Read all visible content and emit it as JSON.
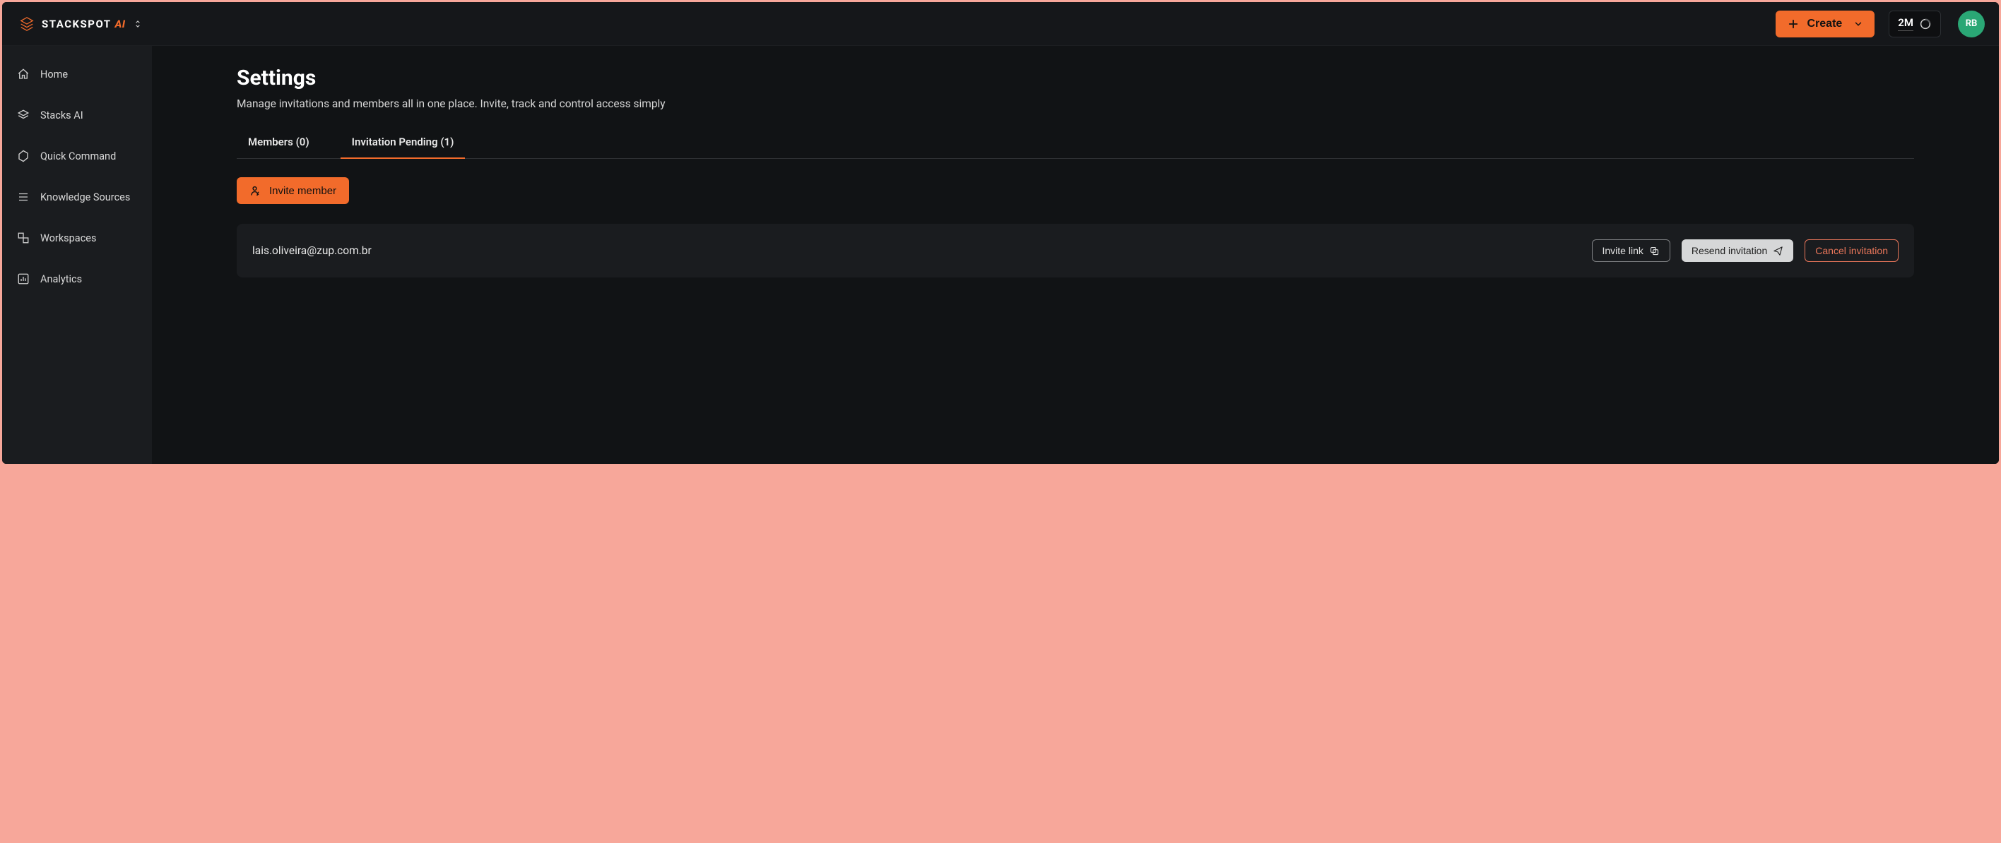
{
  "brand": {
    "name": "STACKSPOT",
    "suffix": "AI"
  },
  "header": {
    "create_label": "Create",
    "token_count": "2M",
    "avatar_initials": "RB"
  },
  "sidebar": {
    "items": [
      {
        "label": "Home"
      },
      {
        "label": "Stacks AI"
      },
      {
        "label": "Quick Command"
      },
      {
        "label": "Knowledge Sources"
      },
      {
        "label": "Workspaces"
      },
      {
        "label": "Analytics"
      }
    ]
  },
  "page": {
    "title": "Settings",
    "subtitle": "Manage invitations and members all in one place. Invite, track and control access simply"
  },
  "tabs": {
    "members": {
      "label": "Members (0)",
      "count": 0,
      "active": false
    },
    "pending": {
      "label": "Invitation Pending (1)",
      "count": 1,
      "active": true
    }
  },
  "actions": {
    "invite_member": "Invite member",
    "invite_link": "Invite link",
    "resend_invitation": "Resend invitation",
    "cancel_invitation": "Cancel invitation"
  },
  "invitations": [
    {
      "email": "lais.oliveira@zup.com.br"
    }
  ],
  "colors": {
    "accent": "#f26b2b",
    "bg": "#111315",
    "panel": "#1a1c1f",
    "danger": "#e9765a",
    "avatar": "#2aa775"
  }
}
